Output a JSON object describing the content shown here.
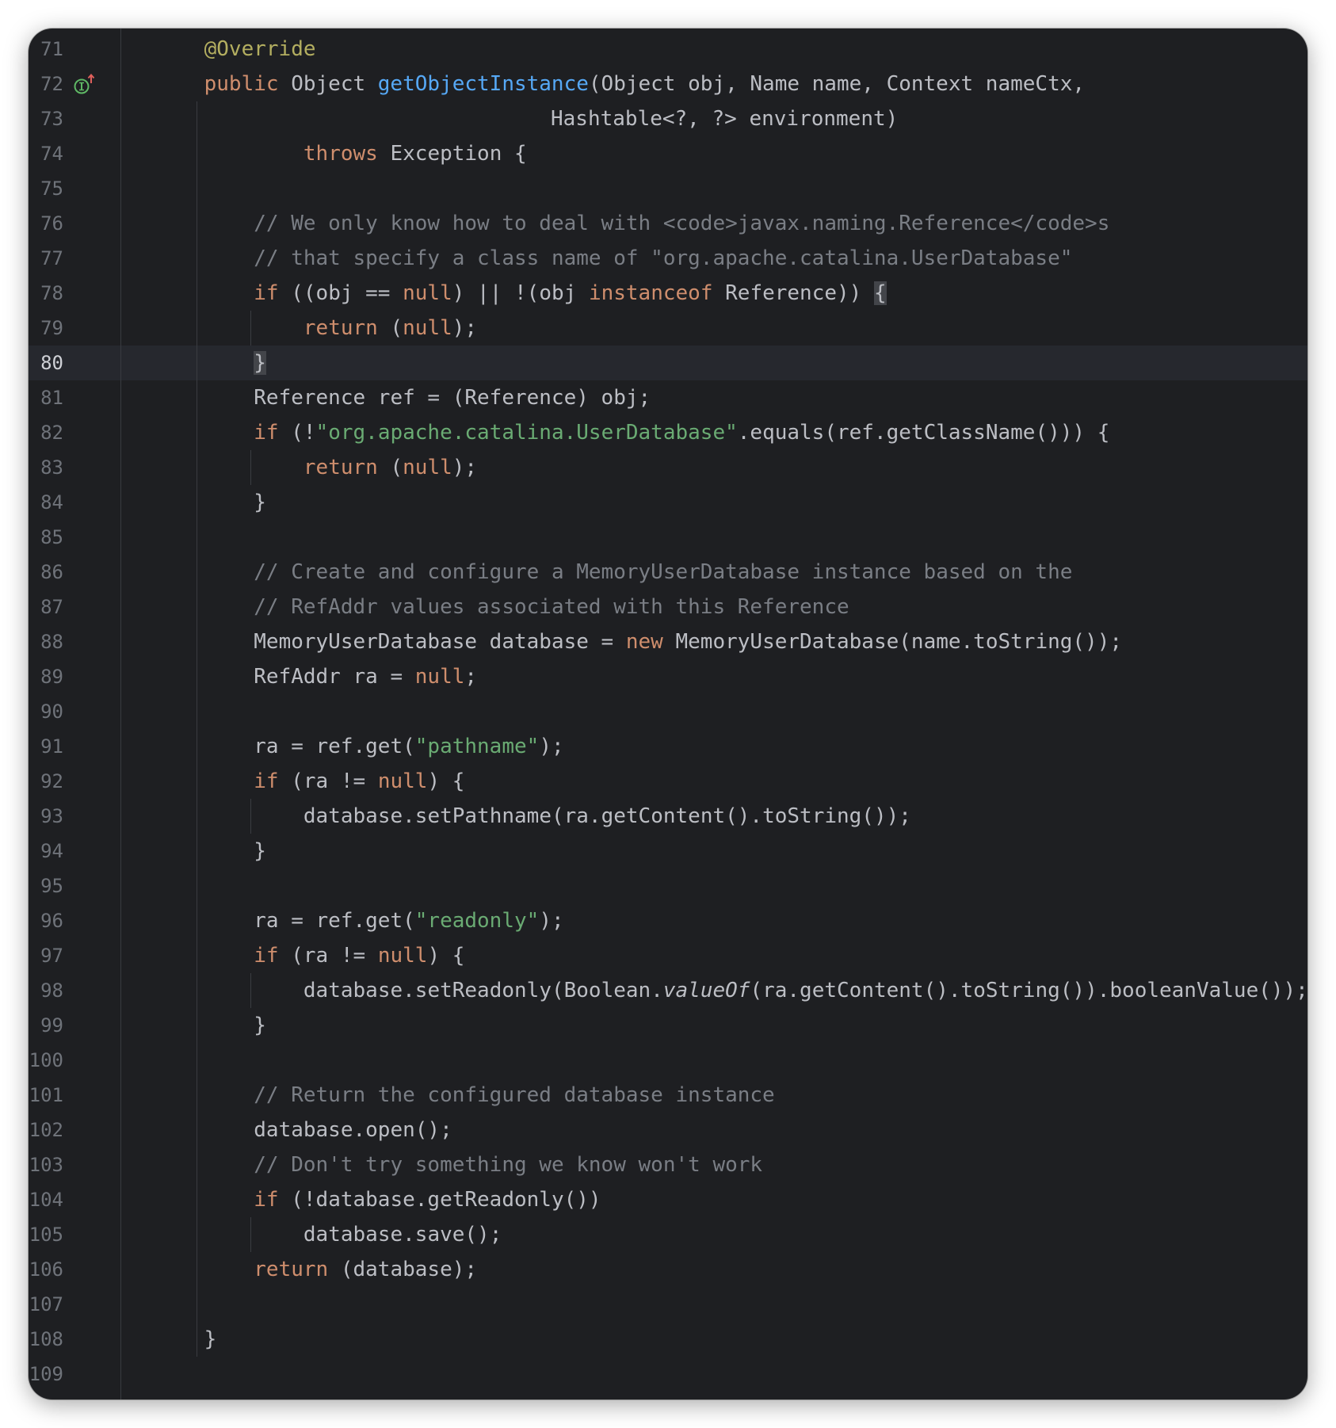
{
  "editor": {
    "current_line": "80",
    "gutter_icon": "implementation-up-arrow-icon",
    "colors": {
      "background": "#1e1f22",
      "keyword": "#cf8e6d",
      "annotation": "#b3ae60",
      "function": "#56a8f5",
      "string": "#6aab73",
      "comment": "#7a7e85",
      "text": "#bcbec4"
    },
    "lines": [
      {
        "no": "71",
        "indent": 1,
        "tokens": [
          {
            "t": "@Override",
            "c": "anno"
          }
        ]
      },
      {
        "no": "72",
        "indent": 1,
        "tokens": [
          {
            "t": "public",
            "c": "kw"
          },
          {
            "t": " Object ",
            "c": ""
          },
          {
            "t": "getObjectInstance",
            "c": "fn"
          },
          {
            "t": "(Object obj, Name name, Context nameCtx,",
            "c": ""
          }
        ]
      },
      {
        "no": "73",
        "indent": 9,
        "tokens": [
          {
            "t": "Hashtable<?, ?> environment)",
            "c": ""
          }
        ]
      },
      {
        "no": "74",
        "indent": 3,
        "tokens": [
          {
            "t": "throws",
            "c": "kw"
          },
          {
            "t": " Exception {",
            "c": ""
          }
        ]
      },
      {
        "no": "75",
        "indent": 0,
        "tokens": []
      },
      {
        "no": "76",
        "indent": 2,
        "tokens": [
          {
            "t": "// We only know how to deal with <code>javax.naming.Reference</code>s",
            "c": "cm"
          }
        ]
      },
      {
        "no": "77",
        "indent": 2,
        "tokens": [
          {
            "t": "// that specify a class name of \"org.apache.catalina.UserDatabase\"",
            "c": "cm"
          }
        ]
      },
      {
        "no": "78",
        "indent": 2,
        "tokens": [
          {
            "t": "if",
            "c": "kw"
          },
          {
            "t": " ((obj == ",
            "c": ""
          },
          {
            "t": "null",
            "c": "kw"
          },
          {
            "t": ") || !(obj ",
            "c": ""
          },
          {
            "t": "instanceof",
            "c": "kw"
          },
          {
            "t": " Reference)) ",
            "c": ""
          },
          {
            "t": "{",
            "c": "hl"
          }
        ]
      },
      {
        "no": "79",
        "indent": 3,
        "tokens": [
          {
            "t": "return",
            "c": "kw"
          },
          {
            "t": " (",
            "c": ""
          },
          {
            "t": "null",
            "c": "kw"
          },
          {
            "t": ");",
            "c": ""
          }
        ]
      },
      {
        "no": "80",
        "indent": 2,
        "tokens": [
          {
            "t": "}",
            "c": "hl"
          }
        ]
      },
      {
        "no": "81",
        "indent": 2,
        "tokens": [
          {
            "t": "Reference ref = (Reference) obj;",
            "c": ""
          }
        ]
      },
      {
        "no": "82",
        "indent": 2,
        "tokens": [
          {
            "t": "if",
            "c": "kw"
          },
          {
            "t": " (!",
            "c": ""
          },
          {
            "t": "\"org.apache.catalina.UserDatabase\"",
            "c": "str"
          },
          {
            "t": ".equals(ref.getClassName())) {",
            "c": ""
          }
        ]
      },
      {
        "no": "83",
        "indent": 3,
        "tokens": [
          {
            "t": "return",
            "c": "kw"
          },
          {
            "t": " (",
            "c": ""
          },
          {
            "t": "null",
            "c": "kw"
          },
          {
            "t": ");",
            "c": ""
          }
        ]
      },
      {
        "no": "84",
        "indent": 2,
        "tokens": [
          {
            "t": "}",
            "c": ""
          }
        ]
      },
      {
        "no": "85",
        "indent": 0,
        "tokens": []
      },
      {
        "no": "86",
        "indent": 2,
        "tokens": [
          {
            "t": "// Create and configure a MemoryUserDatabase instance based on the",
            "c": "cm"
          }
        ]
      },
      {
        "no": "87",
        "indent": 2,
        "tokens": [
          {
            "t": "// RefAddr values associated with this Reference",
            "c": "cm"
          }
        ]
      },
      {
        "no": "88",
        "indent": 2,
        "tokens": [
          {
            "t": "MemoryUserDatabase database = ",
            "c": ""
          },
          {
            "t": "new",
            "c": "kw"
          },
          {
            "t": " MemoryUserDatabase(name.toString());",
            "c": ""
          }
        ]
      },
      {
        "no": "89",
        "indent": 2,
        "tokens": [
          {
            "t": "RefAddr ra = ",
            "c": ""
          },
          {
            "t": "null",
            "c": "kw"
          },
          {
            "t": ";",
            "c": ""
          }
        ]
      },
      {
        "no": "90",
        "indent": 0,
        "tokens": []
      },
      {
        "no": "91",
        "indent": 2,
        "tokens": [
          {
            "t": "ra = ref.get(",
            "c": ""
          },
          {
            "t": "\"pathname\"",
            "c": "str"
          },
          {
            "t": ");",
            "c": ""
          }
        ]
      },
      {
        "no": "92",
        "indent": 2,
        "tokens": [
          {
            "t": "if",
            "c": "kw"
          },
          {
            "t": " (ra != ",
            "c": ""
          },
          {
            "t": "null",
            "c": "kw"
          },
          {
            "t": ") {",
            "c": ""
          }
        ]
      },
      {
        "no": "93",
        "indent": 3,
        "tokens": [
          {
            "t": "database.setPathname(ra.getContent().toString());",
            "c": ""
          }
        ]
      },
      {
        "no": "94",
        "indent": 2,
        "tokens": [
          {
            "t": "}",
            "c": ""
          }
        ]
      },
      {
        "no": "95",
        "indent": 0,
        "tokens": []
      },
      {
        "no": "96",
        "indent": 2,
        "tokens": [
          {
            "t": "ra = ref.get(",
            "c": ""
          },
          {
            "t": "\"readonly\"",
            "c": "str"
          },
          {
            "t": ");",
            "c": ""
          }
        ]
      },
      {
        "no": "97",
        "indent": 2,
        "tokens": [
          {
            "t": "if",
            "c": "kw"
          },
          {
            "t": " (ra != ",
            "c": ""
          },
          {
            "t": "null",
            "c": "kw"
          },
          {
            "t": ") {",
            "c": ""
          }
        ]
      },
      {
        "no": "98",
        "indent": 3,
        "tokens": [
          {
            "t": "database.setReadonly(Boolean.",
            "c": ""
          },
          {
            "t": "valueOf",
            "c": "it"
          },
          {
            "t": "(ra.getContent().toString()).booleanValue());",
            "c": ""
          }
        ]
      },
      {
        "no": "99",
        "indent": 2,
        "tokens": [
          {
            "t": "}",
            "c": ""
          }
        ]
      },
      {
        "no": "100",
        "indent": 0,
        "tokens": []
      },
      {
        "no": "101",
        "indent": 2,
        "tokens": [
          {
            "t": "// Return the configured database instance",
            "c": "cm"
          }
        ]
      },
      {
        "no": "102",
        "indent": 2,
        "tokens": [
          {
            "t": "database.open();",
            "c": ""
          }
        ]
      },
      {
        "no": "103",
        "indent": 2,
        "tokens": [
          {
            "t": "// Don't try something we know won't work",
            "c": "cm"
          }
        ]
      },
      {
        "no": "104",
        "indent": 2,
        "tokens": [
          {
            "t": "if",
            "c": "kw"
          },
          {
            "t": " (!database.getReadonly())",
            "c": ""
          }
        ]
      },
      {
        "no": "105",
        "indent": 3,
        "tokens": [
          {
            "t": "database.save();",
            "c": ""
          }
        ]
      },
      {
        "no": "106",
        "indent": 2,
        "tokens": [
          {
            "t": "return",
            "c": "kw"
          },
          {
            "t": " (database);",
            "c": ""
          }
        ]
      },
      {
        "no": "107",
        "indent": 0,
        "tokens": []
      },
      {
        "no": "108",
        "indent": 1,
        "tokens": [
          {
            "t": "}",
            "c": ""
          }
        ]
      },
      {
        "no": "109",
        "indent": 0,
        "tokens": []
      }
    ]
  }
}
